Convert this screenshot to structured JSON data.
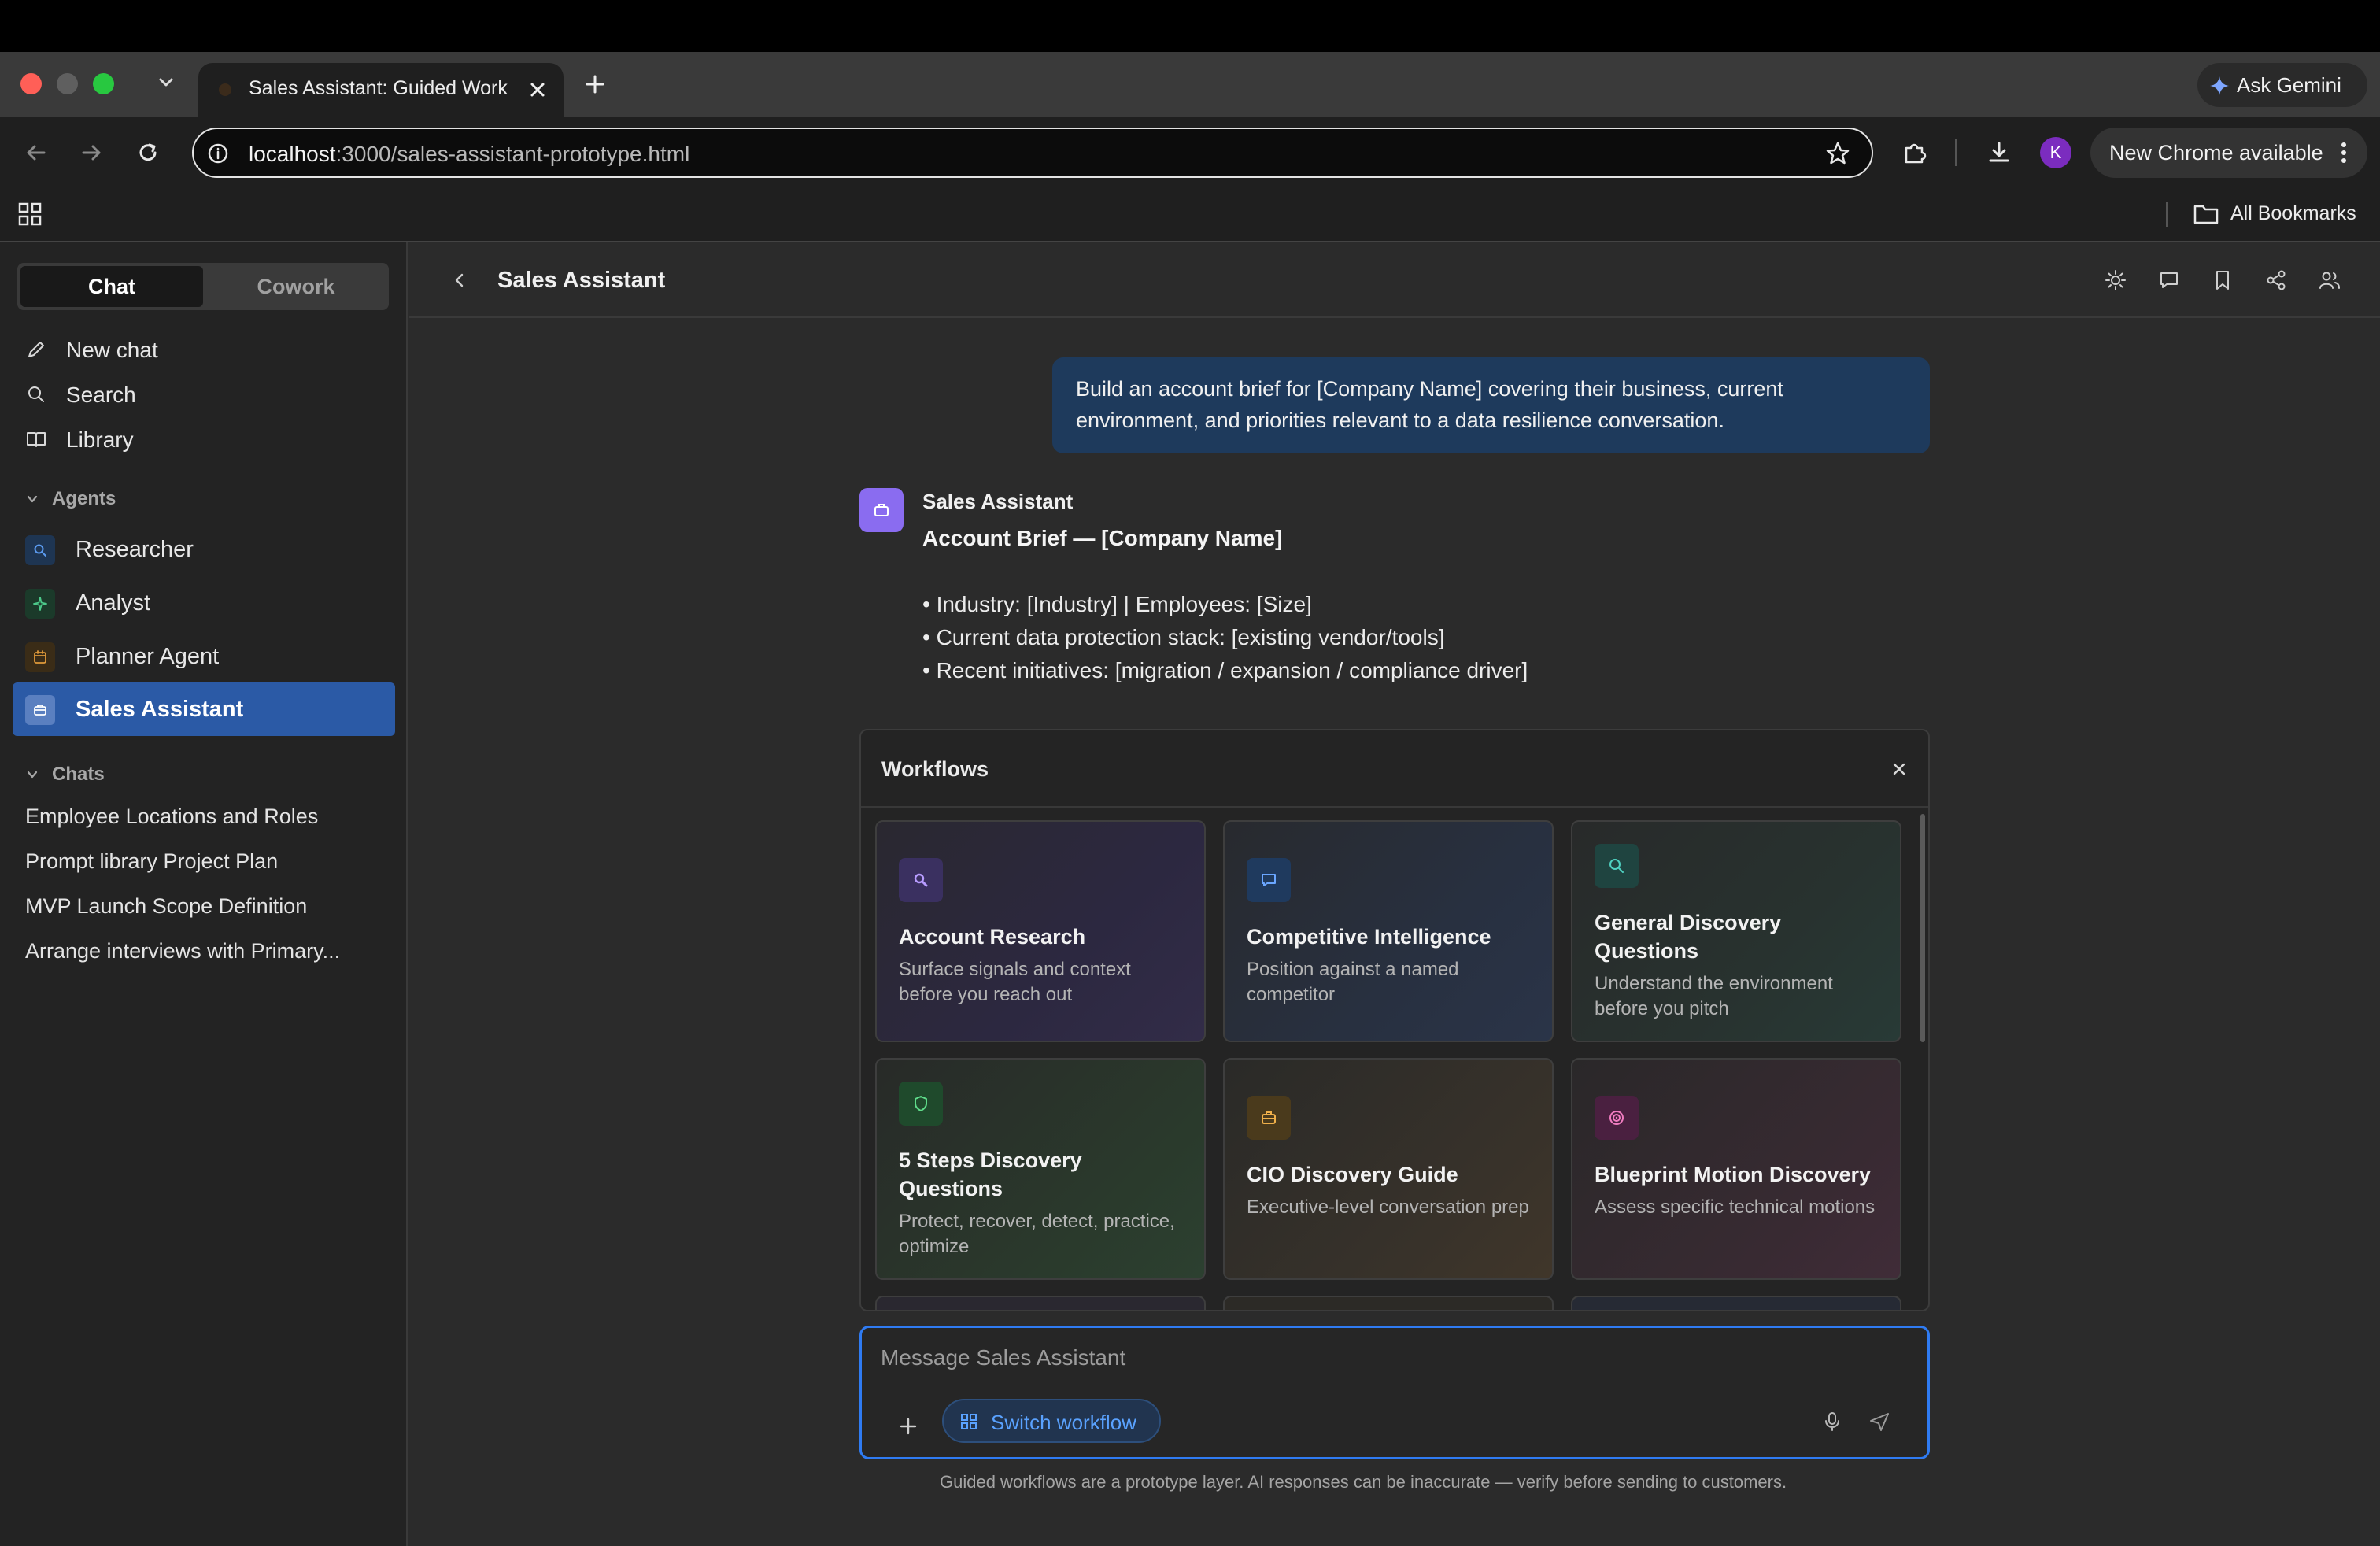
{
  "browser": {
    "tab_title": "Sales Assistant: Guided Work",
    "url_host": "localhost",
    "url_path": ":3000/sales-assistant-prototype.html",
    "ask_gemini": "Ask Gemini",
    "profile_initial": "K",
    "new_chrome": "New Chrome available",
    "all_bookmarks": "All Bookmarks"
  },
  "sidebar": {
    "mode_tabs": {
      "chat": "Chat",
      "cowork": "Cowork",
      "selected": "Chat"
    },
    "links": {
      "new_chat": "New chat",
      "search": "Search",
      "library": "Library"
    },
    "agents_header": "Agents",
    "agents": [
      {
        "label": "Researcher",
        "icon": "search-icon",
        "color": "#4f8fe8"
      },
      {
        "label": "Analyst",
        "icon": "sparkle-icon",
        "color": "#3fbf7f"
      },
      {
        "label": "Planner Agent",
        "icon": "calendar-icon",
        "color": "#e09a3a"
      },
      {
        "label": "Sales Assistant",
        "icon": "briefcase-icon",
        "color": "#ffffff",
        "active": true
      }
    ],
    "chats_header": "Chats",
    "chats": [
      "Employee Locations and Roles",
      "Prompt library Project Plan",
      "MVP Launch Scope Definition",
      "Arrange interviews with Primary..."
    ]
  },
  "header": {
    "title": "Sales Assistant",
    "icons": [
      "sun-icon",
      "comment-icon",
      "bookmark-icon",
      "share-icon",
      "users-icon"
    ]
  },
  "conversation": {
    "user_message": "Build an account brief for [Company Name] covering their business, current environment, and priorities relevant to a data resilience conversation.",
    "assistant": {
      "name": "Sales Assistant",
      "title": "Account Brief — [Company Name]",
      "lines": [
        "• Industry: [Industry]  |  Employees: [Size]",
        "• Current data protection stack: [existing vendor/tools]",
        "• Recent initiatives: [migration / expansion / compliance driver]"
      ]
    }
  },
  "workflows": {
    "title": "Workflows",
    "cards": [
      {
        "title": "Account Research",
        "desc": "Surface signals and context before you reach out",
        "icon": "magnifier-icon",
        "color": "#9b7cf0"
      },
      {
        "title": "Competitive Intelligence",
        "desc": "Position against a named competitor",
        "icon": "chat-bubble-icon",
        "color": "#4f8fe8"
      },
      {
        "title": "General Discovery Questions",
        "desc": "Understand the environment before you pitch",
        "icon": "search-icon",
        "color": "#3fbfb0"
      },
      {
        "title": "5 Steps Discovery Questions",
        "desc": "Protect, recover, detect, practice, optimize",
        "icon": "shield-icon",
        "color": "#4cc97a"
      },
      {
        "title": "CIO Discovery Guide",
        "desc": "Executive-level conversation prep",
        "icon": "briefcase-icon",
        "color": "#e0a040"
      },
      {
        "title": "Blueprint Motion Discovery",
        "desc": "Assess specific technical motions",
        "icon": "target-icon",
        "color": "#e06aa8"
      }
    ]
  },
  "composer": {
    "placeholder": "Message Sales Assistant",
    "switch_workflow": "Switch workflow",
    "accent": "#2f7bf2"
  },
  "footnote": "Guided workflows are a prototype layer. AI responses can be inaccurate — verify before sending to customers."
}
